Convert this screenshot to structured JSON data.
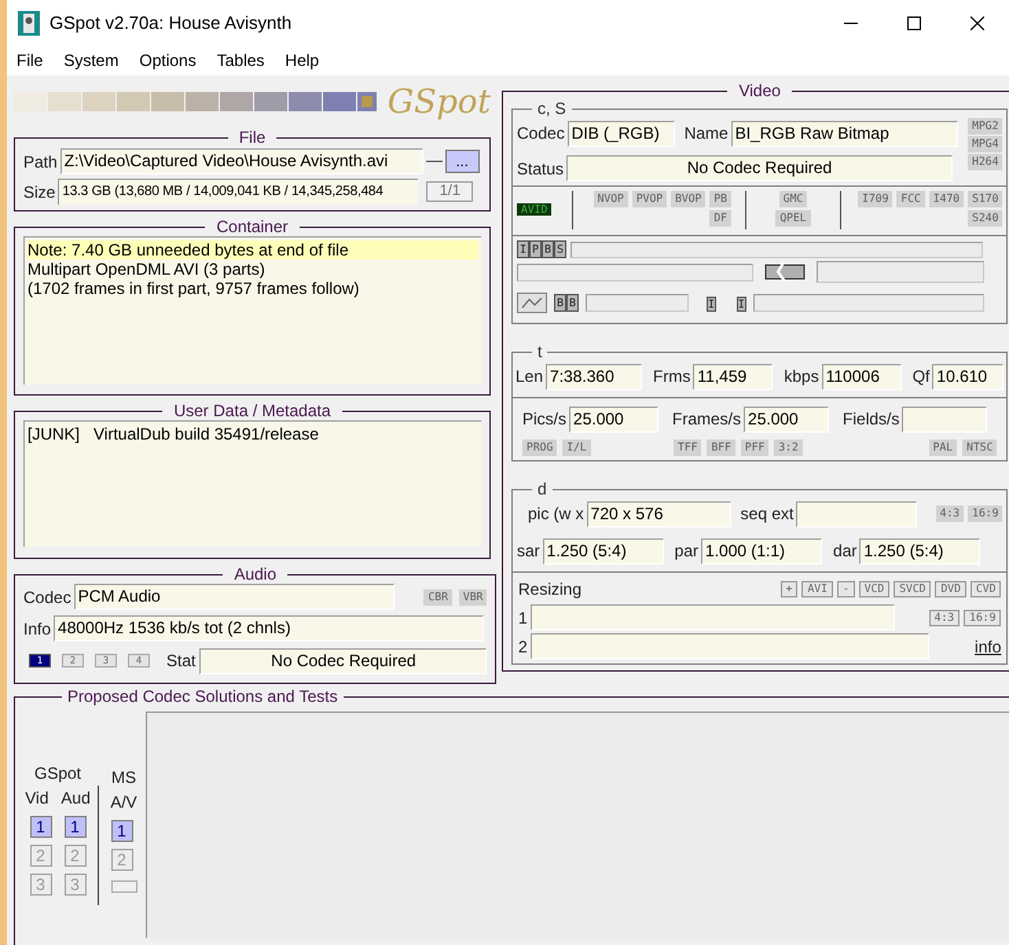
{
  "window": {
    "title": "GSpot v2.70a: House Avisynth"
  },
  "menu": [
    "File",
    "System",
    "Options",
    "Tables",
    "Help"
  ],
  "logo": "GSpot",
  "file": {
    "title": "File",
    "path_label": "Path",
    "path": "Z:\\Video\\Captured Video\\House Avisynth.avi",
    "browse": "...",
    "size_label": "Size",
    "size": "13.3 GB (13,680 MB / 14,009,041 KB / 14,345,258,484",
    "part": "1/1"
  },
  "container": {
    "title": "Container",
    "lines": [
      {
        "text": "Note: 7.40 GB unneeded bytes at end of file",
        "highlighted": true
      },
      {
        "text": "Multipart OpenDML AVI (3 parts)",
        "highlighted": false
      },
      {
        "text": "(1702 frames in first part, 9757 frames follow)",
        "highlighted": false
      }
    ]
  },
  "user_data": {
    "title": "User Data / Metadata",
    "rows": [
      {
        "tag": "[JUNK]",
        "value": "VirtualDub build 35491/release"
      }
    ]
  },
  "audio": {
    "title": "Audio",
    "codec_label": "Codec",
    "codec": "PCM Audio",
    "flags": [
      {
        "label": "CBR",
        "active": false
      },
      {
        "label": "VBR",
        "active": false
      }
    ],
    "info_label": "Info",
    "info": "48000Hz  1536 kb/s tot (2 chnls)",
    "streams": [
      {
        "label": "1",
        "selected": true
      },
      {
        "label": "2",
        "selected": false
      },
      {
        "label": "3",
        "selected": false
      },
      {
        "label": "4",
        "selected": false
      }
    ],
    "stat_label": "Stat",
    "stat": "No Codec Required"
  },
  "video": {
    "title": "Video",
    "cs": {
      "title": "c, S",
      "codec_label": "Codec",
      "codec": "DIB (_RGB)",
      "name_label": "Name",
      "name": "BI_RGB Raw Bitmap",
      "status_label": "Status",
      "status": "No Codec Required",
      "format_flags": [
        {
          "label": "MPG2",
          "active": false
        },
        {
          "label": "MPG4",
          "active": false
        },
        {
          "label": "H264",
          "active": false
        }
      ],
      "avid": {
        "label": "AVID",
        "active": true
      },
      "vop_flags": [
        {
          "label": "NVOP",
          "active": false
        },
        {
          "label": "PVOP",
          "active": false
        },
        {
          "label": "BVOP",
          "active": false
        },
        {
          "label": "PB",
          "active": false
        },
        {
          "label": "DF",
          "active": false
        }
      ],
      "motion_flags": [
        {
          "label": "GMC",
          "active": false
        },
        {
          "label": "QPEL",
          "active": false
        }
      ],
      "matrix_flags": [
        {
          "label": "I709",
          "active": false
        },
        {
          "label": "FCC",
          "active": false
        },
        {
          "label": "I470",
          "active": false
        },
        {
          "label": "S170",
          "active": false
        },
        {
          "label": "S240",
          "active": false
        }
      ],
      "frame_types": [
        "I",
        "P",
        "B",
        "S"
      ],
      "b_frames": [
        "B",
        "B"
      ],
      "i_frames": [
        "I",
        "I"
      ]
    },
    "t": {
      "title": "t",
      "len_label": "Len",
      "len": "7:38.360",
      "frms_label": "Frms",
      "frms": "11,459",
      "kbps_label": "kbps",
      "kbps": "110006",
      "qf_label": "Qf",
      "qf": "10.610",
      "pics_label": "Pics/s",
      "pics": "25.000",
      "frames_label": "Frames/s",
      "frames": "25.000",
      "fields_label": "Fields/s",
      "scan_flags": [
        {
          "label": "PROG",
          "active": false
        },
        {
          "label": "I/L",
          "active": false
        }
      ],
      "field_flags": [
        {
          "label": "TFF",
          "active": false
        },
        {
          "label": "BFF",
          "active": false
        },
        {
          "label": "PFF",
          "active": false
        },
        {
          "label": "3:2",
          "active": false
        }
      ],
      "standard_flags": [
        {
          "label": "PAL",
          "active": false
        },
        {
          "label": "NTSC",
          "active": false
        }
      ]
    },
    "d": {
      "title": "d",
      "pic_label": "pic (w x",
      "pic": "720 x 576",
      "seq_label": "seq ext",
      "aspect_flags": [
        {
          "label": "4:3",
          "active": false
        },
        {
          "label": "16:9",
          "active": false
        }
      ],
      "sar_label": "sar",
      "sar": "1.250 (5:4)",
      "par_label": "par",
      "par": "1.000 (1:1)",
      "dar_label": "dar",
      "dar": "1.250 (5:4)",
      "resizing_label": "Resizing",
      "resize_buttons": [
        "+",
        "AVI",
        "-",
        "VCD",
        "SVCD",
        "DVD",
        "CVD"
      ],
      "row1_label": "1",
      "row1_buttons": [
        "4:3",
        "16:9"
      ],
      "row2_label": "2",
      "info_link": "info"
    }
  },
  "proposed": {
    "title": "Proposed Codec Solutions and Tests",
    "gspot_label": "GSpot",
    "vid_label": "Vid",
    "aud_label": "Aud",
    "ms_label": "MS",
    "av_label": "A/V",
    "vid": [
      {
        "label": "1",
        "selected": true
      },
      {
        "label": "2",
        "selected": false
      },
      {
        "label": "3",
        "selected": false
      }
    ],
    "aud": [
      {
        "label": "1",
        "selected": true
      },
      {
        "label": "2",
        "selected": false
      },
      {
        "label": "3",
        "selected": false
      }
    ],
    "av": [
      {
        "label": "1",
        "selected": true
      },
      {
        "label": "2",
        "selected": false
      }
    ]
  }
}
